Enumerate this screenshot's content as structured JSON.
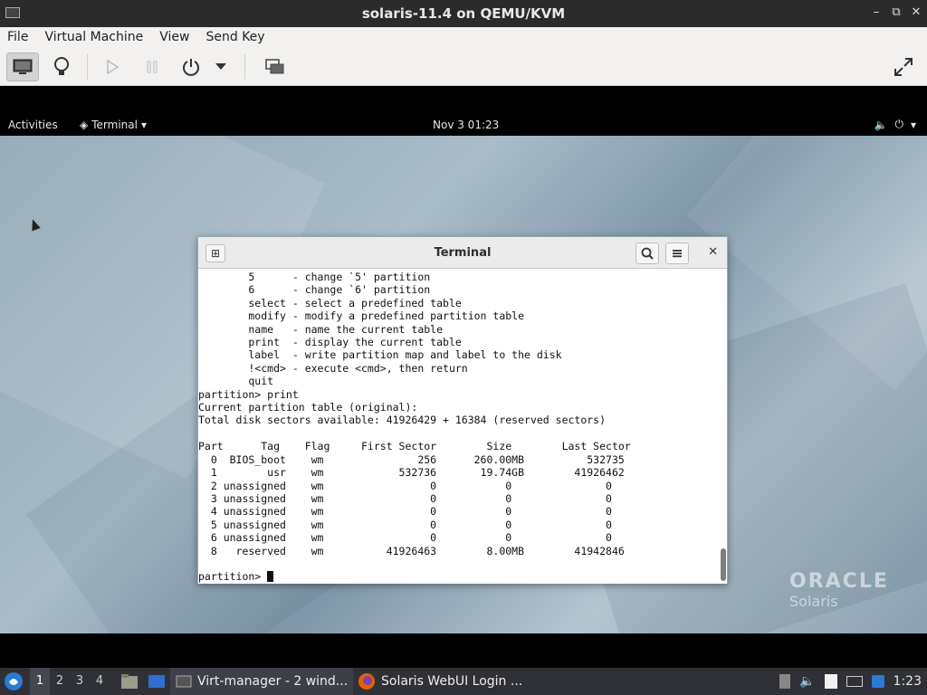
{
  "host": {
    "title": "solaris-11.4 on QEMU/KVM",
    "menu": [
      "File",
      "Virtual Machine",
      "View",
      "Send Key"
    ]
  },
  "gnome": {
    "activities": "Activities",
    "app_menu": "Terminal",
    "clock": "Nov 3  01:23"
  },
  "terminal": {
    "title": "Terminal",
    "lines": [
      "        5      - change `5' partition",
      "        6      - change `6' partition",
      "        select - select a predefined table",
      "        modify - modify a predefined partition table",
      "        name   - name the current table",
      "        print  - display the current table",
      "        label  - write partition map and label to the disk",
      "        !<cmd> - execute <cmd>, then return",
      "        quit",
      "partition> print",
      "Current partition table (original):",
      "Total disk sectors available: 41926429 + 16384 (reserved sectors)",
      "",
      "Part      Tag    Flag     First Sector        Size        Last Sector",
      "  0  BIOS_boot    wm               256      260.00MB          532735",
      "  1        usr    wm            532736       19.74GB        41926462",
      "  2 unassigned    wm                 0           0               0",
      "  3 unassigned    wm                 0           0               0",
      "  4 unassigned    wm                 0           0               0",
      "  5 unassigned    wm                 0           0               0",
      "  6 unassigned    wm                 0           0               0",
      "  8   reserved    wm          41926463        8.00MB        41942846",
      ""
    ],
    "prompt": "partition> "
  },
  "branding": {
    "oracle": "ORACLE",
    "solaris": "Solaris"
  },
  "taskbar": {
    "workspaces": [
      "1",
      "2",
      "3",
      "4"
    ],
    "tasks": [
      {
        "label": "Virt-manager - 2 wind..."
      },
      {
        "label": "Solaris WebUI Login ..."
      }
    ],
    "clock": "1:23"
  }
}
